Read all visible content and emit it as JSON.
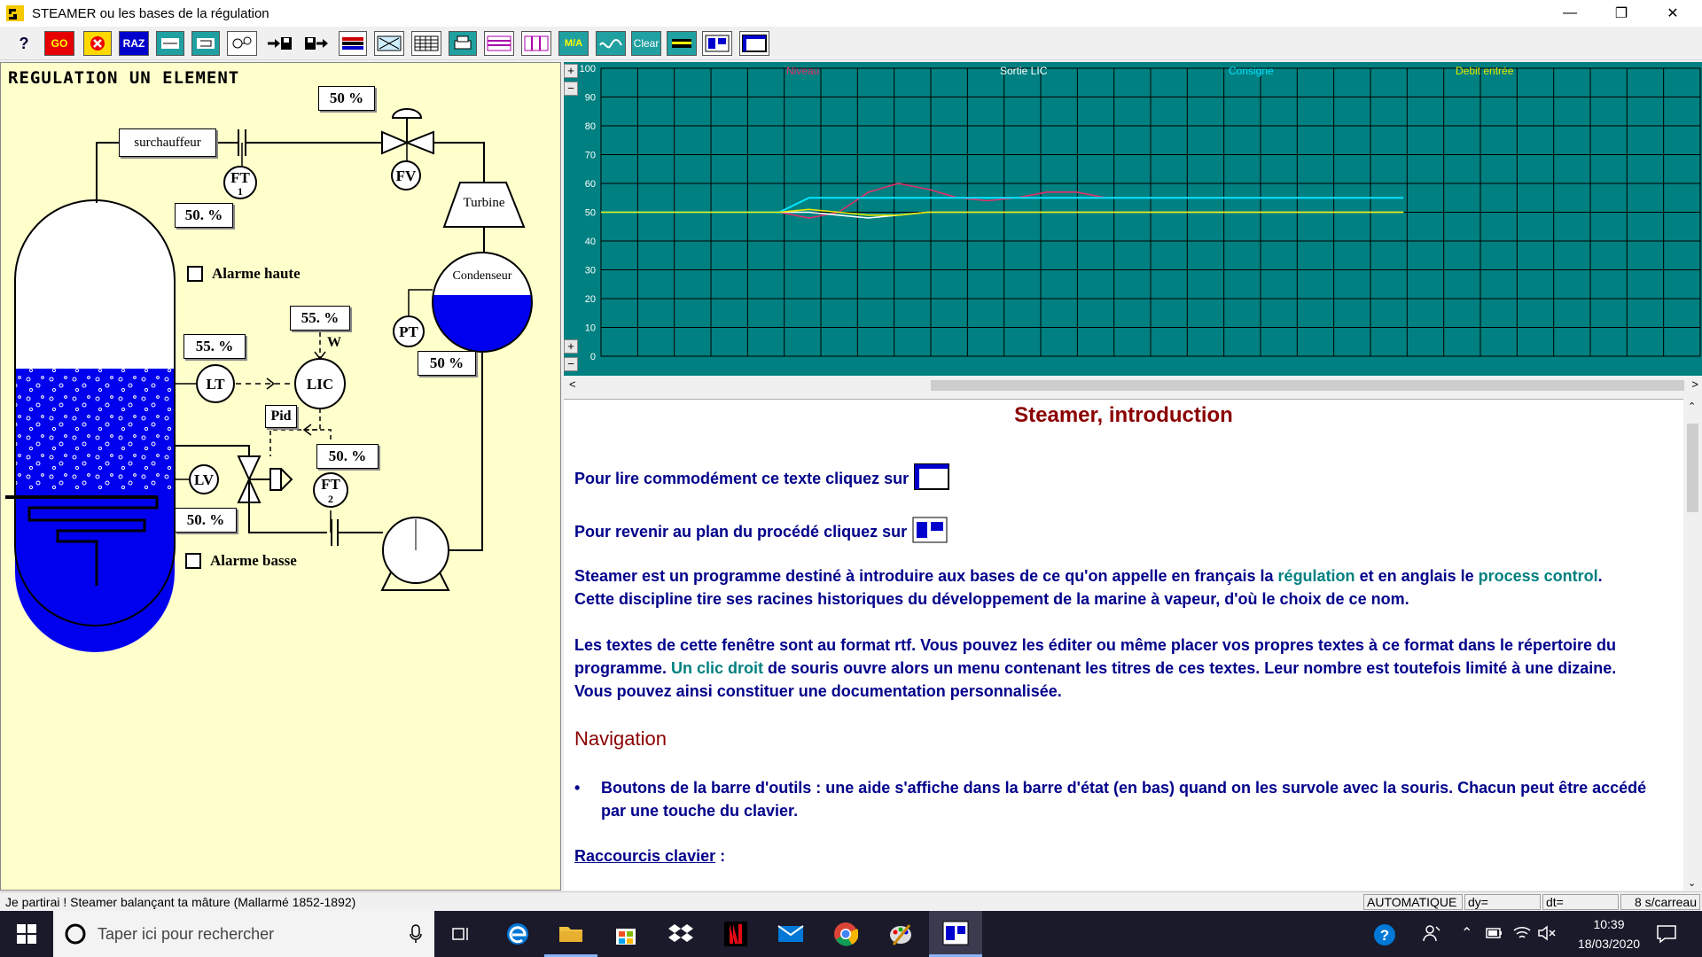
{
  "window": {
    "title": "STEAMER ou les bases de la régulation"
  },
  "toolbar": {
    "help": "?",
    "go": "GO",
    "raz": "RAZ",
    "clear": "Clear",
    "ma": "M/A"
  },
  "diagram": {
    "title": "REGULATION UN ELEMENT",
    "surchauffeur": "surchauffeur",
    "turbine": "Turbine",
    "condenseur": "Condenseur",
    "valve_top_pct": "50 %",
    "steam_flow_pct": "50. %",
    "level_pct": "55. %",
    "setpoint_pct": "55. %",
    "setpoint_w": "W",
    "condenser_pct": "50 %",
    "feed_flow_pct": "50. %",
    "lv_pct": "50. %",
    "pid": "Pid",
    "alarm_high": "Alarme haute",
    "alarm_low": "Alarme basse",
    "instruments": {
      "ft1": "FT",
      "ft1_n": "1",
      "fv": "FV",
      "lt": "LT",
      "lic": "LIC",
      "lv": "LV",
      "ft2": "FT",
      "ft2_n": "2",
      "pt": "PT"
    }
  },
  "chart_data": {
    "type": "line",
    "ylim": [
      0,
      100
    ],
    "yticks": [
      "100",
      "90",
      "80",
      "70",
      "60",
      "50",
      "40",
      "30",
      "20",
      "10",
      "0"
    ],
    "series": [
      {
        "name": "Niveau",
        "color": "#e0306a",
        "values": [
          50,
          50,
          50,
          50,
          50,
          50,
          50,
          48,
          50,
          57,
          60,
          58,
          55,
          54,
          55,
          57,
          57,
          55,
          55,
          55,
          55,
          55,
          55,
          55,
          55,
          55,
          55,
          55
        ]
      },
      {
        "name": "Sortie LIC",
        "color": "#ffffff",
        "values": [
          50,
          50,
          50,
          50,
          50,
          50,
          50,
          50,
          49,
          48,
          49,
          50,
          50,
          50,
          50,
          50,
          50,
          50,
          50,
          50,
          50,
          50,
          50,
          50,
          50,
          50,
          50,
          50
        ]
      },
      {
        "name": "Consigne",
        "color": "#00e5ff",
        "values": [
          50,
          50,
          50,
          50,
          50,
          50,
          50,
          55,
          55,
          55,
          55,
          55,
          55,
          55,
          55,
          55,
          55,
          55,
          55,
          55,
          55,
          55,
          55,
          55,
          55,
          55,
          55,
          55
        ]
      },
      {
        "name": "Debit entrée",
        "color": "#e8e800",
        "values": [
          50,
          50,
          50,
          50,
          50,
          50,
          50,
          51,
          50,
          49,
          49,
          50,
          50,
          50,
          50,
          50,
          50,
          50,
          50,
          50,
          50,
          50,
          50,
          50,
          50,
          50,
          50,
          50
        ]
      }
    ],
    "legend_placement": "top",
    "grid": true
  },
  "text": {
    "heading": "Steamer, introduction",
    "line1": "Pour lire commodément ce texte cliquez sur",
    "line2": "Pour revenir au plan du procédé cliquez sur",
    "p1a": "Steamer est un programme destiné à introduire aux bases de ce qu'on appelle en français la ",
    "p1b": "régulation",
    "p1c": " et en anglais le ",
    "p1d": "process control",
    "p1e": ".",
    "p1f": "Cette discipline tire ses racines historiques du développement de la marine à vapeur, d'où le choix de ce nom.",
    "p2a": "Les textes de cette fenêtre sont au format rtf. Vous pouvez les éditer ou même placer vos propres textes à ce format dans le répertoire du programme. ",
    "p2b": "Un clic droit",
    "p2c": " de souris ouvre alors un menu contenant les titres de ces textes. Leur nombre est toutefois limité à une dizaine.",
    "p2d": "Vous pouvez ainsi constituer une documentation personnalisée.",
    "nav": "Navigation",
    "bullet1": "Boutons de la barre d'outils : une aide s'affiche dans la barre d'état (en bas) quand on les survole avec la souris. Chacun peut être accédé par une touche du clavier.",
    "shortcuts": "Raccourcis clavier",
    "shortcuts_colon": " :"
  },
  "status": {
    "quote": "Je partirai ! Steamer balançant ta mâture   (Mallarmé 1852-1892)",
    "mode": "AUTOMATIQUE",
    "dy": "dy=",
    "dt": "dt=",
    "rate": "8 s/carreau"
  },
  "taskbar": {
    "search_placeholder": "Taper ici pour rechercher",
    "time": "10:39",
    "date": "18/03/2020"
  }
}
